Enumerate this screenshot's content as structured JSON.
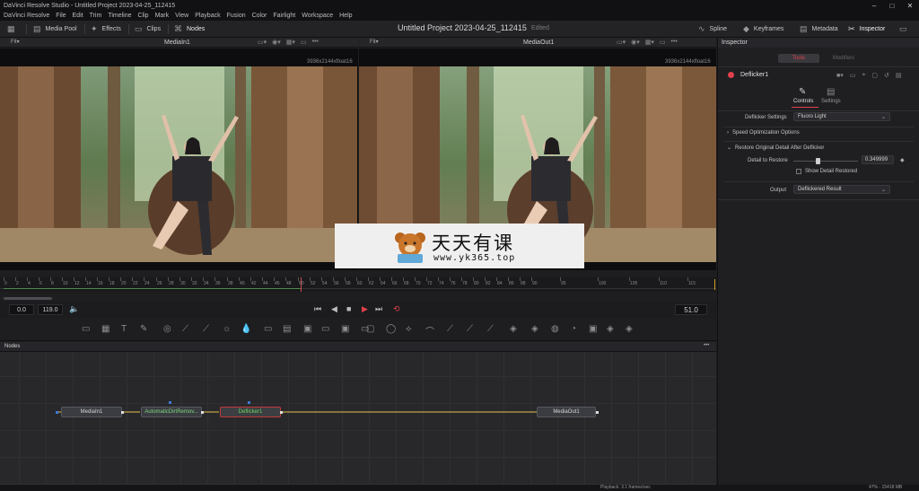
{
  "window": {
    "title": "DaVinci Resolve Studio - Untitled Project 2023-04-25_112415"
  },
  "menu": [
    "DaVinci Resolve",
    "File",
    "Edit",
    "Trim",
    "Timeline",
    "Clip",
    "Mark",
    "View",
    "Playback",
    "Fusion",
    "Color",
    "Fairlight",
    "Workspace",
    "Help"
  ],
  "toolbar": {
    "media_pool": "Media Pool",
    "effects": "Effects",
    "clips": "Clips",
    "nodes": "Nodes",
    "project_title": "Untitled Project 2023-04-25_112415",
    "project_status": "Edited",
    "spline": "Spline",
    "keyframes": "Keyframes",
    "metadata": "Metadata",
    "inspector": "Inspector"
  },
  "viewer_left": {
    "fit": "Fit▾",
    "name": "MediaIn1",
    "resolution": "3936x2144xfloat16"
  },
  "viewer_right": {
    "fit": "Fit▾",
    "name": "MediaOut1",
    "resolution": "3936x2144xfloat16"
  },
  "ruler_labels": [
    "0",
    "2",
    "4",
    "6",
    "8",
    "10",
    "12",
    "14",
    "16",
    "18",
    "20",
    "22",
    "24",
    "26",
    "28",
    "30",
    "32",
    "34",
    "36",
    "38",
    "40",
    "42",
    "44",
    "46",
    "48",
    "50",
    "52",
    "54",
    "56",
    "58",
    "60",
    "62",
    "64",
    "66",
    "68",
    "70",
    "72",
    "74",
    "76",
    "78",
    "80",
    "82",
    "84",
    "86",
    "88",
    "90",
    "95",
    "100",
    "105",
    "110",
    "115"
  ],
  "transport": {
    "start": "0.0",
    "end": "119.0",
    "current": "51.0"
  },
  "nodes_panel": {
    "title": "Nodes",
    "more": "•••",
    "nodes": [
      {
        "label": "MediaIn1"
      },
      {
        "label": "AutomaticDirtRemov..."
      },
      {
        "label": "Deflicker1"
      },
      {
        "label": "MediaOut1"
      }
    ]
  },
  "inspector": {
    "title": "Inspector",
    "tabs": {
      "tools": "Tools",
      "modifiers": "Modifiers"
    },
    "node_name": "Deflicker1",
    "subtabs": {
      "controls": "Controls",
      "settings": "Settings"
    },
    "deflicker_settings_label": "Deflicker Settings",
    "deflicker_settings_value": "Fluoro Light",
    "speed_opt": "Speed Optimization Options",
    "restore": "Restore Original Detail After Deflicker",
    "detail_label": "Detail to Restore",
    "detail_value": "0.349999",
    "show_detail": "Show Detail Restored",
    "output_label": "Output",
    "output_value": "Deflickered Result"
  },
  "status": {
    "playback": "Playback: 3.1 frames/sec",
    "memory": "47% - 15418 MB"
  },
  "watermark": {
    "cn": "天天有课",
    "url": "www.yk365.top"
  },
  "colors": {
    "accent_red": "#e0404a",
    "node_link": "#e6c04a",
    "node_green": "#7fd67f"
  }
}
